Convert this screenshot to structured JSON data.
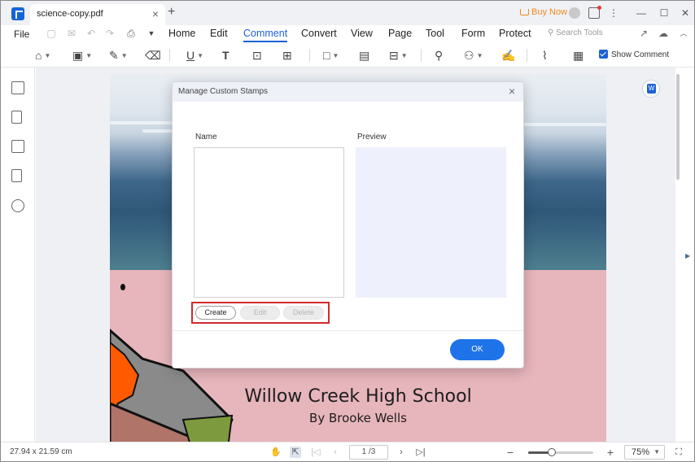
{
  "titlebar": {
    "tab_label": "science-copy.pdf",
    "tab_close": "×",
    "tab_add": "+",
    "buy_now": "Buy Now",
    "kebab": "⋮",
    "minimize": "—",
    "maximize": "☐",
    "close": "✕"
  },
  "menu": {
    "file": "File",
    "items": [
      "Home",
      "Edit",
      "Comment",
      "Convert",
      "View",
      "Page",
      "Tool",
      "Form",
      "Protect"
    ],
    "active": "Comment",
    "search_placeholder": "Search Tools"
  },
  "toolbar": {
    "show_comment_label": "Show Comment",
    "show_comment_checked": true
  },
  "document": {
    "title": "Willow Creek High School",
    "author": "By Brooke Wells"
  },
  "dialog": {
    "title": "Manage Custom Stamps",
    "close": "×",
    "name_label": "Name",
    "preview_label": "Preview",
    "create_button": "Create",
    "edit_button": "Edit",
    "delete_button": "Delete",
    "ok_button": "OK"
  },
  "statusbar": {
    "dimensions": "27.94 x 21.59 cm",
    "page_indicator": "1 /3",
    "zoom_level": "75%",
    "zoom_fraction": 0.36
  },
  "colors": {
    "accent": "#1c62d6",
    "ok_button": "#1e73e8",
    "highlight_box": "#d12b2b",
    "buy_now": "#f08a24",
    "page_background": "#e7b5bc"
  }
}
